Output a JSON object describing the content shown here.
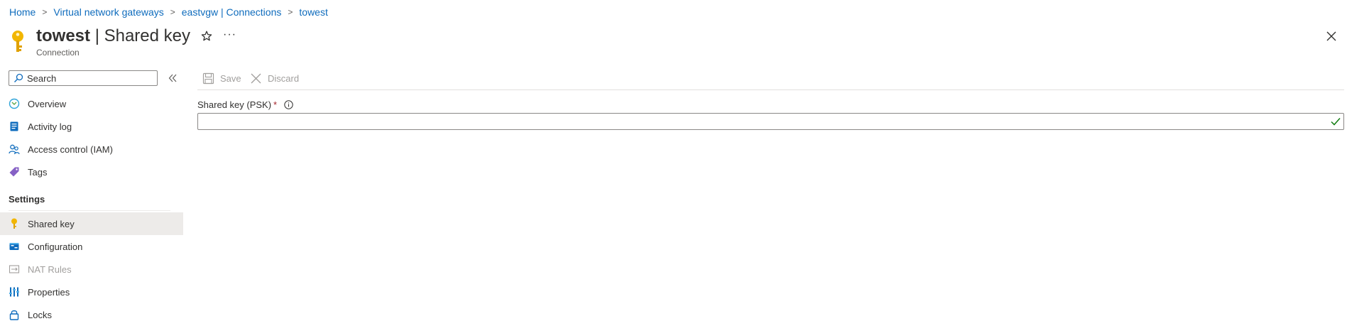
{
  "breadcrumb": {
    "items": [
      "Home",
      "Virtual network gateways",
      "eastvgw | Connections",
      "towest"
    ],
    "separator": ">"
  },
  "header": {
    "resource_name": "towest",
    "divider": "|",
    "blade_name": "Shared key",
    "resource_type": "Connection",
    "more_label": "···"
  },
  "sidebar": {
    "search_placeholder": "Search",
    "items": [
      {
        "label": "Overview",
        "icon": "overview-icon"
      },
      {
        "label": "Activity log",
        "icon": "activity-log-icon"
      },
      {
        "label": "Access control (IAM)",
        "icon": "iam-icon"
      },
      {
        "label": "Tags",
        "icon": "tag-icon"
      }
    ],
    "settings_title": "Settings",
    "settings_items": [
      {
        "label": "Shared key",
        "icon": "key-icon",
        "selected": true
      },
      {
        "label": "Configuration",
        "icon": "configuration-icon"
      },
      {
        "label": "NAT Rules",
        "icon": "nat-rules-icon",
        "disabled": true
      },
      {
        "label": "Properties",
        "icon": "properties-icon"
      },
      {
        "label": "Locks",
        "icon": "lock-icon"
      }
    ]
  },
  "toolbar": {
    "save_label": "Save",
    "discard_label": "Discard"
  },
  "form": {
    "psk_label": "Shared key (PSK)",
    "required_marker": "*",
    "psk_value": "",
    "valid": true
  },
  "colors": {
    "link": "#0f6cbd",
    "selected_bg": "#edebe9",
    "required": "#a4262c",
    "key": "#f2b600",
    "valid_check": "#107c10"
  }
}
